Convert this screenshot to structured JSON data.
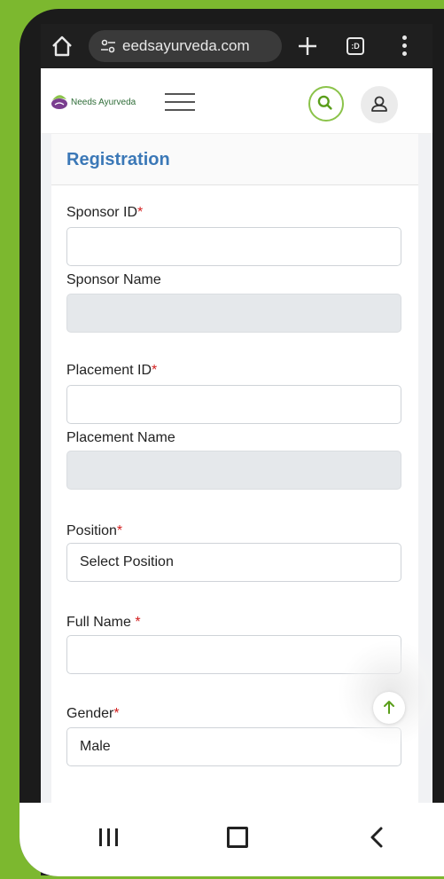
{
  "browser": {
    "url": "eedsayurveda.com",
    "tab_count": ":D"
  },
  "site": {
    "logo_text": "Needs Ayurveda"
  },
  "form": {
    "title": "Registration",
    "sponsor_id_label": "Sponsor ID",
    "sponsor_id_value": "",
    "sponsor_name_label": "Sponsor Name",
    "sponsor_name_value": "",
    "placement_id_label": "Placement ID",
    "placement_id_value": "",
    "placement_name_label": "Placement Name",
    "placement_name_value": "",
    "position_label": "Position",
    "position_value": "Select Position",
    "full_name_label": "Full Name ",
    "full_name_value": "",
    "gender_label": "Gender",
    "gender_value": "Male",
    "required_mark": "*"
  },
  "colors": {
    "brand_green": "#8bc34a",
    "title_blue": "#3b78b7",
    "required_red": "#d32020",
    "page_bg": "#7cb82f"
  },
  "icons": {
    "home": "home-icon",
    "site_settings": "tune-icon",
    "new_tab": "plus-icon",
    "tabs": "tab-switcher-icon",
    "menu": "more-vert-icon",
    "search": "search-icon",
    "user": "user-icon",
    "scroll_top": "arrow-up-icon",
    "nav_recents": "recents-icon",
    "nav_home": "nav-home-icon",
    "nav_back": "back-icon"
  }
}
